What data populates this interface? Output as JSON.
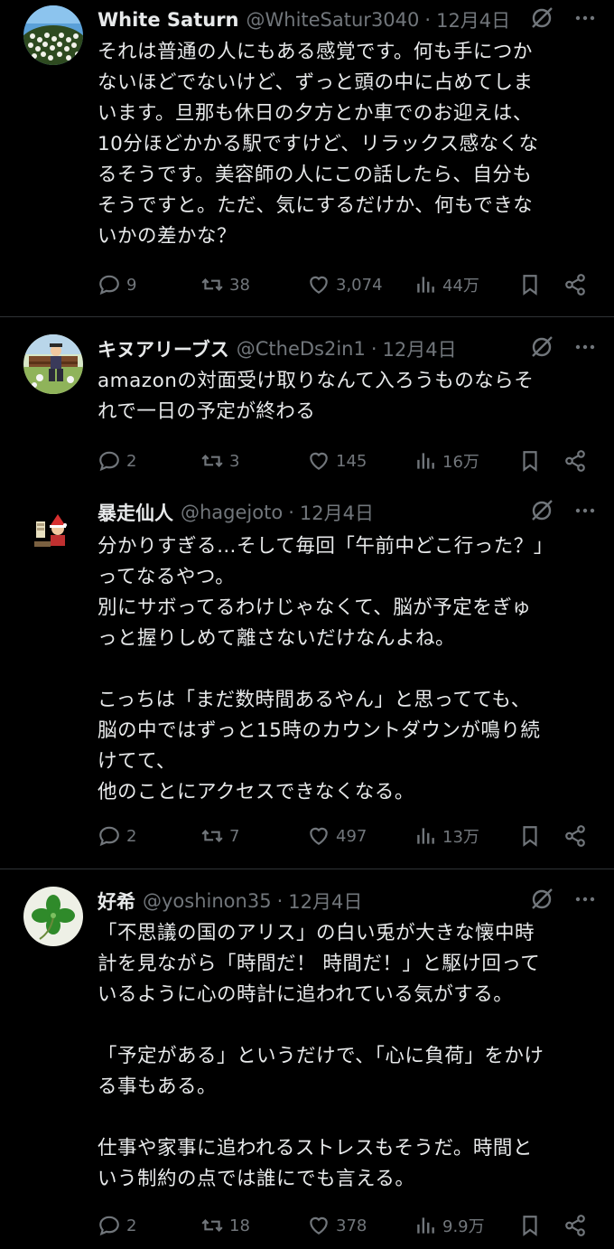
{
  "posts": [
    {
      "name": "White Saturn",
      "handle": "@WhiteSatur3040",
      "date": "12月4日",
      "text": "それは普通の人にもある感覚です。何も手につか\nないほどでないけど、ずっと頭の中に占めてしま\nいます。旦那も休日の夕方とか車でのお迎えは、\n10分ほどかかる駅ですけど、リラックス感なくな\nるそうです。美容師の人にこの話したら、自分も\nそうですと。ただ、気にするだけか、何もできな\nいかの差かな？",
      "replies": "9",
      "reposts": "38",
      "likes": "3,074",
      "views": "44万"
    },
    {
      "name": "キヌアリーブス",
      "handle": "@CtheDs2in1",
      "date": "12月4日",
      "text": "amazonの対面受け取りなんて入ろうものならそ\nれで一日の予定が終わる",
      "replies": "2",
      "reposts": "3",
      "likes": "145",
      "views": "16万"
    },
    {
      "name": "暴走仙人",
      "handle": "@hagejoto",
      "date": "12月4日",
      "text": "分かりすぎる…そして毎回「午前中どこ行った？」\nってなるやつ。\n別にサボってるわけじゃなくて、脳が予定をぎゅ\nっと握りしめて離さないだけなんよね。\n\nこっちは「まだ数時間あるやん」と思ってても、\n脳の中ではずっと15時のカウントダウンが鳴り続\nけてて、\n他のことにアクセスできなくなる。",
      "replies": "2",
      "reposts": "7",
      "likes": "497",
      "views": "13万"
    },
    {
      "name": "好希",
      "handle": "@yoshinon35",
      "date": "12月4日",
      "text": "「不思議の国のアリス」の白い兎が大きな懐中時\n計を見ながら「時間だ！ 時間だ！」と駆け回って\nいるように心の時計に追われている気がする。\n\n「予定がある」というだけで、「心に負荷」をかけ\nる事もある。\n\n仕事や家事に追われるストレスもそうだ。時間と\nいう制約の点では誰にでも言える。",
      "replies": "2",
      "reposts": "18",
      "likes": "378",
      "views": "9.9万"
    }
  ],
  "icons": {
    "reply": "reply-icon",
    "repost": "repost-icon",
    "like": "heart-icon",
    "views": "views-icon",
    "bookmark": "bookmark-icon",
    "share": "share-icon",
    "grok": "grok-icon",
    "more": "more-icon"
  },
  "colors": {
    "background": "#000000",
    "text": "#e7e9ea",
    "muted": "#71767b",
    "divider": "#2f3336"
  }
}
